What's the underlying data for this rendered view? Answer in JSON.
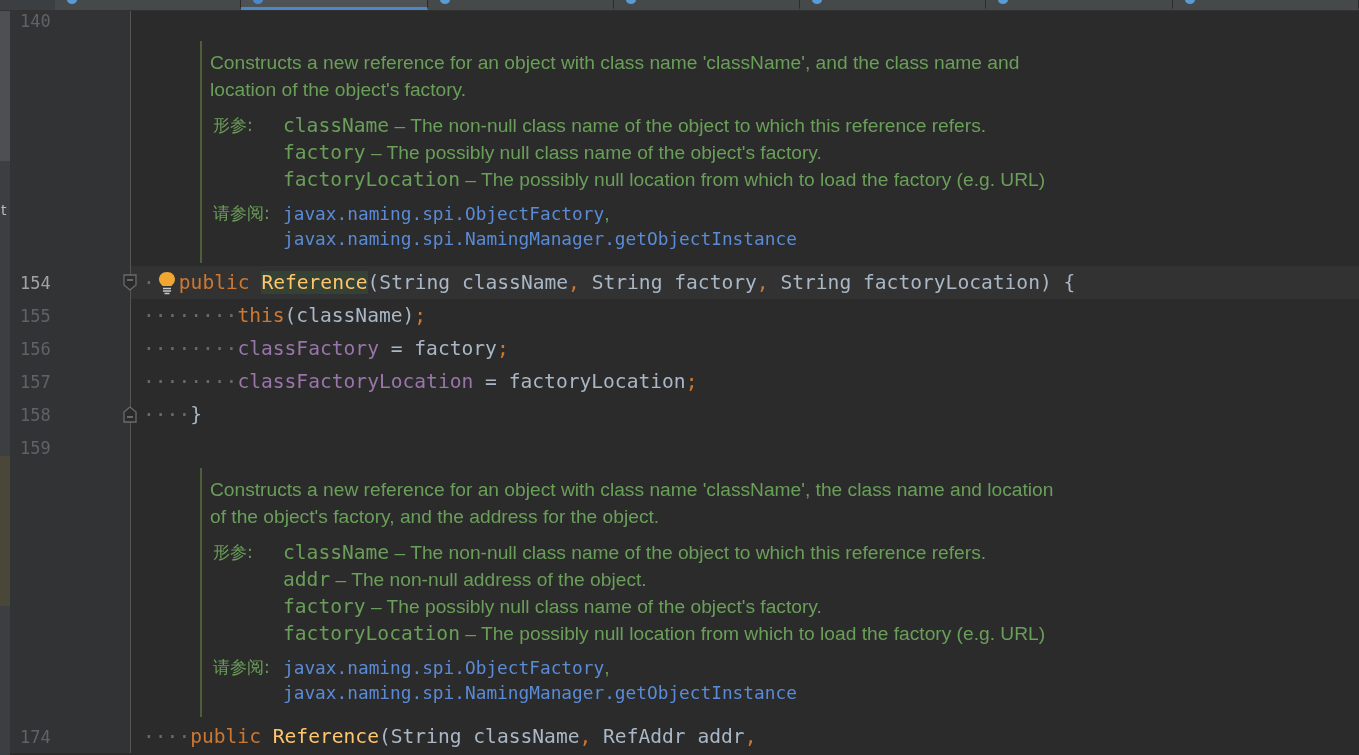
{
  "tabs": [
    {
      "selected": false
    },
    {
      "selected": true
    },
    {
      "selected": false
    },
    {
      "selected": false
    },
    {
      "selected": false
    },
    {
      "selected": false
    },
    {
      "selected": false
    }
  ],
  "side_panel": {
    "text": "t"
  },
  "editor": {
    "lines": [
      {
        "kind": "code",
        "number": "140",
        "current": false
      },
      {
        "kind": "doc",
        "summary": "Constructs a new reference for an object with class name 'className', and the class name and location of the object's factory.",
        "params_label": "形参:",
        "params": [
          {
            "name": "className",
            "text": "– The non-null class name of the object to which this reference refers."
          },
          {
            "name": "factory",
            "text": "– The possibly null class name of the object's factory."
          },
          {
            "name": "factoryLocation",
            "text": "– The possibly null location from which to load the factory (e.g. URL)"
          }
        ],
        "see_label": "请参阅:",
        "see": [
          {
            "link": "javax.naming.spi.ObjectFactory",
            "suffix": ","
          },
          {
            "link": "javax.naming.spi.NamingManager.getObjectInstance"
          }
        ]
      },
      {
        "kind": "code",
        "number": "154",
        "current": true,
        "fold_open": true,
        "tokens": [
          {
            "kind": "ws",
            "text": "·"
          },
          {
            "kind": "bulb"
          },
          {
            "kind": "keyword",
            "text": "public "
          },
          {
            "kind": "declaration",
            "text": "Reference",
            "highlight": true
          },
          {
            "kind": "plain",
            "text": "(String className"
          },
          {
            "kind": "punct",
            "text": ", "
          },
          {
            "kind": "plain",
            "text": "String factory"
          },
          {
            "kind": "punct",
            "text": ", "
          },
          {
            "kind": "plain",
            "text": "String factoryLocation) {"
          }
        ]
      },
      {
        "kind": "code",
        "number": "155",
        "current": false,
        "tokens": [
          {
            "kind": "ws",
            "text": "········"
          },
          {
            "kind": "keyword",
            "text": "this"
          },
          {
            "kind": "plain",
            "text": "(className)"
          },
          {
            "kind": "punct",
            "text": ";"
          }
        ]
      },
      {
        "kind": "code",
        "number": "156",
        "current": false,
        "tokens": [
          {
            "kind": "ws",
            "text": "········"
          },
          {
            "kind": "field",
            "text": "classFactory"
          },
          {
            "kind": "plain",
            "text": " = factory"
          },
          {
            "kind": "punct",
            "text": ";"
          }
        ]
      },
      {
        "kind": "code",
        "number": "157",
        "current": false,
        "tokens": [
          {
            "kind": "ws",
            "text": "········"
          },
          {
            "kind": "field",
            "text": "classFactoryLocation"
          },
          {
            "kind": "plain",
            "text": " = factoryLocation"
          },
          {
            "kind": "punct",
            "text": ";"
          }
        ]
      },
      {
        "kind": "code",
        "number": "158",
        "current": false,
        "fold_close": true,
        "tokens": [
          {
            "kind": "ws",
            "text": "····"
          },
          {
            "kind": "plain",
            "text": "}"
          }
        ]
      },
      {
        "kind": "code",
        "number": "159",
        "current": false
      },
      {
        "kind": "doc",
        "summary": "Constructs a new reference for an object with class name 'className', the class name and location of the object's factory, and the address for the object.",
        "params_label": "形参:",
        "params": [
          {
            "name": "className",
            "text": "– The non-null class name of the object to which this reference refers."
          },
          {
            "name": "addr",
            "text": "– The non-null address of the object."
          },
          {
            "name": "factory",
            "text": "– The possibly null class name of the object's factory."
          },
          {
            "name": "factoryLocation",
            "text": "– The possibly null location from which to load the factory (e.g. URL)"
          }
        ],
        "see_label": "请参阅:",
        "see": [
          {
            "link": "javax.naming.spi.ObjectFactory",
            "suffix": ","
          },
          {
            "link": "javax.naming.spi.NamingManager.getObjectInstance"
          }
        ]
      },
      {
        "kind": "code",
        "number": "174",
        "current": false,
        "tokens": [
          {
            "kind": "ws",
            "text": "····"
          },
          {
            "kind": "keyword",
            "text": "public "
          },
          {
            "kind": "declaration",
            "text": "Reference"
          },
          {
            "kind": "plain",
            "text": "(String className"
          },
          {
            "kind": "punct",
            "text": ", "
          },
          {
            "kind": "plain",
            "text": "RefAddr addr"
          },
          {
            "kind": "punct",
            "text": ","
          }
        ]
      }
    ]
  }
}
